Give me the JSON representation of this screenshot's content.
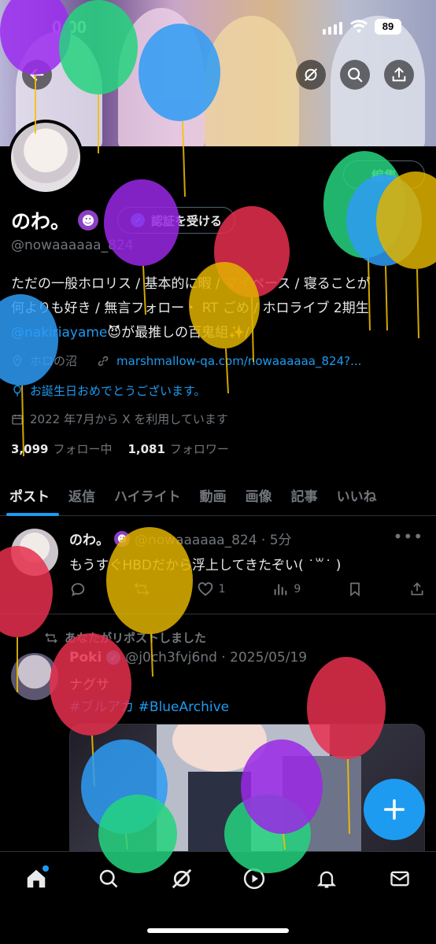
{
  "status_bar": {
    "time": "0:00",
    "battery": "89"
  },
  "profile": {
    "edit_label": "編集",
    "name": "のわ。",
    "devil_emoji": "😈",
    "verify_label": "認証を受ける",
    "handle": "@nowaaaaaa_824",
    "bio_line1": "ただの一般ホロリス / 基本的に暇 / マイペース / 寝ることが",
    "bio_line2": "何よりも好き / 無言フォロー・ RT ごめ / ホロライブ 2期生",
    "bio_mention": "@nakiriayame",
    "bio_line3_rest": "😈が最推しの百鬼組✨/",
    "location": "ホロの沼",
    "website": "marshmallow-qa.com/nowaaaaaa_824?...",
    "birthday": "お誕生日おめでとうございます。",
    "joined": "2022 年7月から X を利用しています",
    "following_count": "3,099",
    "following_label": "フォロー中",
    "followers_count": "1,081",
    "followers_label": "フォロワー"
  },
  "tabs": [
    {
      "label": "ポスト"
    },
    {
      "label": "返信"
    },
    {
      "label": "ハイライト"
    },
    {
      "label": "動画"
    },
    {
      "label": "画像"
    },
    {
      "label": "記事"
    },
    {
      "label": "いいね"
    }
  ],
  "posts": [
    {
      "name": "のわ。",
      "handle_time": "@nowaaaaaa_824 · 5分",
      "text": "もうすぐHBDだから浮上してきたぞい( ˙꒳˙ )",
      "likes": "1",
      "views": "9"
    },
    {
      "repost_label": "あなたがリポストしました",
      "name": "Poki",
      "handle_time": "@j0ch3fvj6nd · 2025/05/19",
      "text": "ナグサ",
      "tag1": "#ブルアカ",
      "tag2": "#BlueArchive"
    }
  ],
  "colors": {
    "accent": "#1d9bf0",
    "background": "#000000",
    "muted": "#71767b"
  },
  "icons": [
    "back-arrow-icon",
    "grok-icon",
    "search-icon",
    "share-icon",
    "home-icon",
    "explore-icon",
    "grok-icon",
    "video-icon",
    "bell-icon",
    "mail-icon"
  ]
}
